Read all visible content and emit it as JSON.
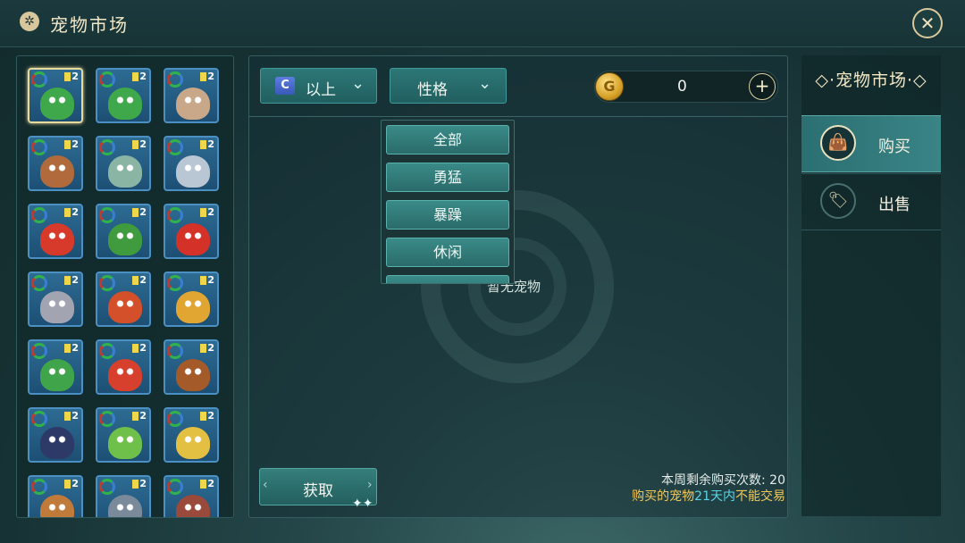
{
  "header": {
    "title": "宠物市场",
    "title_icon": "✲",
    "close_symbol": "✕"
  },
  "pet_grid": {
    "level_label": "2",
    "slots": [
      {
        "color": "#3ea84a"
      },
      {
        "color": "#3ea84a"
      },
      {
        "color": "#c8a889"
      },
      {
        "color": "#b06a3c"
      },
      {
        "color": "#8ab5a4"
      },
      {
        "color": "#b9c6d3"
      },
      {
        "color": "#d73a2a"
      },
      {
        "color": "#3f9b3d"
      },
      {
        "color": "#d43228"
      },
      {
        "color": "#a3a4b2"
      },
      {
        "color": "#d4502a"
      },
      {
        "color": "#e1a632"
      },
      {
        "color": "#3fa44a"
      },
      {
        "color": "#d8402e"
      },
      {
        "color": "#a55a2a"
      },
      {
        "color": "#2d3a68"
      },
      {
        "color": "#6fc04a"
      },
      {
        "color": "#e3c042"
      },
      {
        "color": "#c07a3a"
      },
      {
        "color": "#7a8a9a"
      },
      {
        "color": "#9a4a3a"
      }
    ]
  },
  "filters": {
    "grade_badge": "C",
    "grade_label": "以上",
    "nature_label": "性格",
    "chevron": "⌄"
  },
  "currency": {
    "coin_symbol": "G",
    "amount": "0",
    "add_symbol": "+"
  },
  "nature_menu": {
    "items": [
      "全部",
      "勇猛",
      "暴躁",
      "休闲"
    ]
  },
  "empty_state": "暂无宠物",
  "acquire_button": {
    "label": "获取",
    "left_arrow": "‹",
    "right_arrow": "›",
    "sparkle": "✦✦"
  },
  "info": {
    "weekly_remaining": "本周剩余购买次数: 20",
    "trade_prefix": "购买的宠物",
    "trade_days": "21天内",
    "trade_suffix": "不能交易"
  },
  "sidebar": {
    "title": "宠物市场",
    "title_deco_left": "◇·",
    "title_deco_right": "·◇",
    "tabs": [
      {
        "label": "购买",
        "icon": "bag-icon",
        "glyph": "👜",
        "active": true
      },
      {
        "label": "出售",
        "icon": "tag-icon",
        "glyph": "🏷",
        "active": false
      }
    ]
  }
}
